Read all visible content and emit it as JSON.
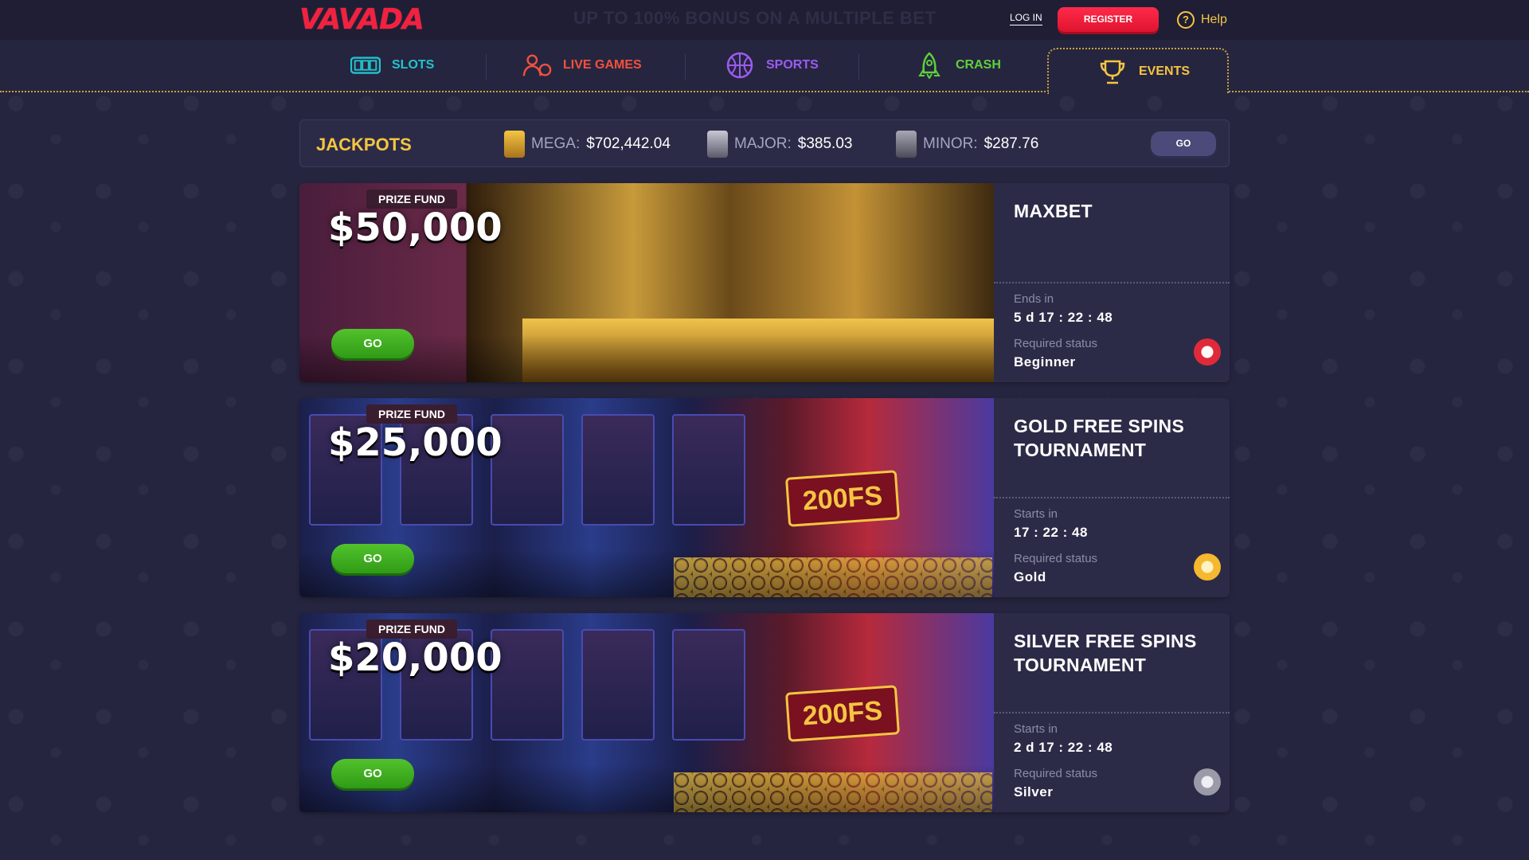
{
  "header": {
    "logo": "VAVADA",
    "promo": "UP TO 100% BONUS ON A MULTIPLE BET",
    "login_label": "LOG IN",
    "register_label": "REGISTER",
    "help_label": "Help",
    "help_icon_glyph": "?"
  },
  "nav": {
    "items": [
      {
        "label": "SLOTS",
        "color": "#21c4cc",
        "icon": "slot-machine-icon"
      },
      {
        "label": "LIVE GAMES",
        "color": "#f2513c",
        "icon": "live-dealer-icon"
      },
      {
        "label": "SPORTS",
        "color": "#9b5cf0",
        "icon": "basketball-icon"
      },
      {
        "label": "CRASH",
        "color": "#5dd13c",
        "icon": "rocket-icon"
      },
      {
        "label": "EVENTS",
        "color": "#f5c542",
        "icon": "trophy-icon",
        "active": true
      }
    ]
  },
  "jackpots": {
    "title": "JACKPOTS",
    "items": [
      {
        "label": "MEGA:",
        "value": "$702,442.04",
        "color": "#d4a237"
      },
      {
        "label": "MAJOR:",
        "value": "$385.03",
        "color": "#8a8a9a"
      },
      {
        "label": "MINOR:",
        "value": "$287.76",
        "color": "#707080"
      }
    ],
    "go_label": "GO"
  },
  "events": [
    {
      "prize_label": "PRIZE FUND",
      "prize_amount": "$50,000",
      "go_label": "GO",
      "title": "MAXBET",
      "time_label": "Ends in",
      "time_value": "5 d 17 : 22 : 48",
      "status_label": "Required status",
      "status_value": "Beginner",
      "badge_color": "#e02a3a"
    },
    {
      "prize_label": "PRIZE FUND",
      "prize_amount": "$25,000",
      "go_label": "GO",
      "banner_sign": "200FS",
      "title": "GOLD FREE SPINS TOURNAMENT",
      "time_label": "Starts in",
      "time_value": "17 : 22 : 48",
      "status_label": "Required status",
      "status_value": "Gold",
      "badge_color": "#f5b82e"
    },
    {
      "prize_label": "PRIZE FUND",
      "prize_amount": "$20,000",
      "go_label": "GO",
      "banner_sign": "200FS",
      "title": "SILVER FREE SPINS TOURNAMENT",
      "time_label": "Starts in",
      "time_value": "2 d 17 : 22 : 48",
      "status_label": "Required status",
      "status_value": "Silver",
      "badge_color": "#b8b8c4"
    }
  ]
}
